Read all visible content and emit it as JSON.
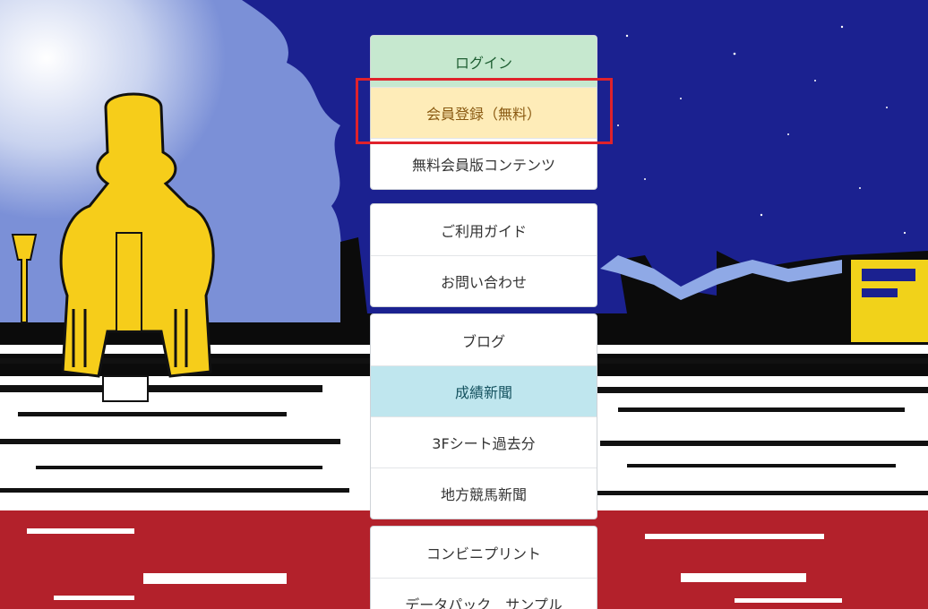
{
  "menu": {
    "group1": [
      {
        "label": "ログイン"
      },
      {
        "label": "会員登録（無料）"
      },
      {
        "label": "無料会員版コンテンツ"
      }
    ],
    "group2": [
      {
        "label": "ご利用ガイド"
      },
      {
        "label": "お問い合わせ"
      }
    ],
    "group3": [
      {
        "label": "ブログ"
      },
      {
        "label": "成績新聞"
      },
      {
        "label": "3Fシート過去分"
      },
      {
        "label": "地方競馬新聞"
      }
    ],
    "group4": [
      {
        "label": "コンビニプリント"
      },
      {
        "label": "データパック　サンプル"
      }
    ]
  },
  "colors": {
    "login_bg": "#c6e8cf",
    "register_bg": "#feecb8",
    "news_bg": "#bfe6ee",
    "highlight": "#e0222b",
    "sky": "#1b2190"
  },
  "icons": {
    "statue": "statue-illustration",
    "billboard": "billboard-illustration"
  }
}
